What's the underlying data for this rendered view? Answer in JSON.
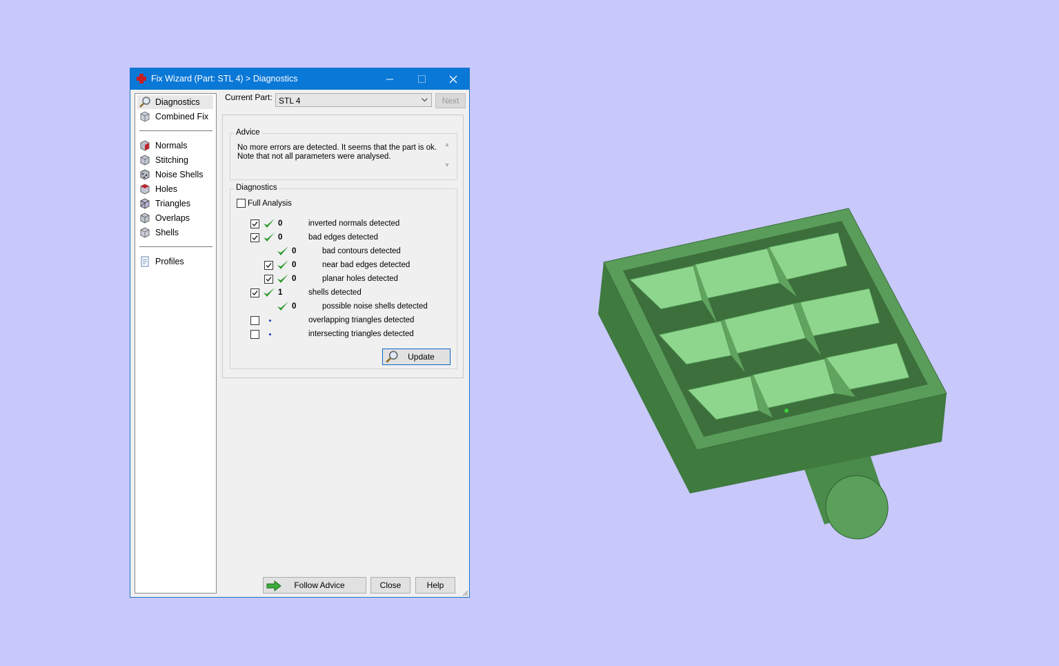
{
  "window": {
    "title": "Fix Wizard (Part: STL 4) > Diagnostics"
  },
  "nav": {
    "items": [
      {
        "label": "Diagnostics",
        "icon": "magnifier-icon",
        "selected": true
      },
      {
        "label": "Combined Fix",
        "icon": "combined-fix-icon"
      },
      {
        "label": "Normals",
        "icon": "normals-icon"
      },
      {
        "label": "Stitching",
        "icon": "stitching-icon"
      },
      {
        "label": "Noise Shells",
        "icon": "noise-shells-icon"
      },
      {
        "label": "Holes",
        "icon": "holes-icon"
      },
      {
        "label": "Triangles",
        "icon": "triangles-icon"
      },
      {
        "label": "Overlaps",
        "icon": "overlaps-icon"
      },
      {
        "label": "Shells",
        "icon": "shells-icon"
      },
      {
        "label": "Profiles",
        "icon": "profiles-icon"
      }
    ]
  },
  "current_part": {
    "label": "Current Part:",
    "value": "STL 4",
    "next_label": "Next"
  },
  "advice": {
    "title": "Advice",
    "line1": "No more errors are detected. It seems that the part is ok.",
    "line2": "Note that not all parameters were analysed."
  },
  "diagnostics": {
    "title": "Diagnostics",
    "full_analysis_label": "Full Analysis",
    "full_analysis_checked": false,
    "rows": [
      {
        "checked": true,
        "status": "ok",
        "count": "0",
        "label": "inverted normals detected"
      },
      {
        "checked": true,
        "status": "ok",
        "count": "0",
        "label": "bad edges detected"
      },
      {
        "checked": null,
        "status": "ok",
        "count": "0",
        "label": "bad contours detected"
      },
      {
        "checked": true,
        "status": "ok",
        "count": "0",
        "label": "near bad edges detected"
      },
      {
        "checked": true,
        "status": "ok",
        "count": "0",
        "label": "planar holes detected"
      },
      {
        "checked": true,
        "status": "ok",
        "count": "1",
        "label": "shells detected"
      },
      {
        "checked": null,
        "status": "ok",
        "count": "0",
        "label": "possible noise shells detected"
      },
      {
        "checked": false,
        "status": "pending",
        "count": "",
        "label": "overlapping triangles detected"
      },
      {
        "checked": false,
        "status": "pending",
        "count": "",
        "label": "intersecting triangles detected"
      }
    ],
    "update_label": "Update"
  },
  "footer": {
    "follow_advice_label": "Follow Advice",
    "close_label": "Close",
    "help_label": "Help"
  },
  "colors": {
    "title_bar": "#0a78d7",
    "background": "#c8c8fa",
    "model_green": "#5fa05f",
    "check_green": "#2f9a2f"
  }
}
